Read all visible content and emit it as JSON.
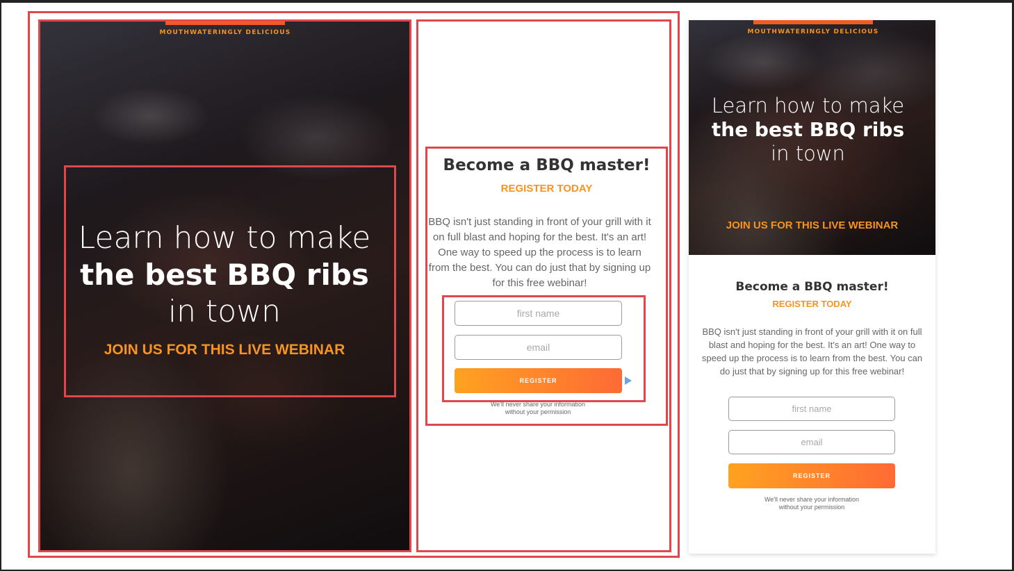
{
  "tagline": "MOUTHWATERINGLY DELICIOUS",
  "hero": {
    "line1": "Learn how to make",
    "line2": "the best BBQ ribs",
    "line3": "in town",
    "cta": "JOIN US FOR THIS LIVE WEBINAR"
  },
  "form": {
    "title": "Become a BBQ master!",
    "subtitle": "REGISTER TODAY",
    "body": "BBQ isn't just standing in front of your grill with it on full blast and hoping for the best. It's an art! One way to speed up the process is to learn from the best. You can do just that by signing up for this free webinar!",
    "first_name_placeholder": "first name",
    "email_placeholder": "email",
    "register_label": "REGISTER",
    "privacy_line1": "We'll never share your information",
    "privacy_line2": "without your permission"
  },
  "colors": {
    "accent_orange": "#f7931e",
    "selection_red": "#e0474c",
    "button_gradient_start": "#ffa220",
    "button_gradient_end": "#ff6a35"
  }
}
